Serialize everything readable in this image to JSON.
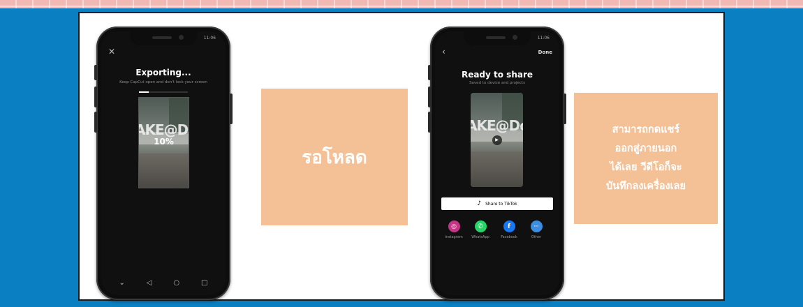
{
  "left_phone": {
    "status_left": "",
    "status_time": "11:06",
    "title": "Exporting...",
    "subtitle": "Keep CapCut open and don't lock your screen",
    "progress_fraction": 0.2,
    "percent_label": "10%",
    "video_sign": "AKE@Dome"
  },
  "right_phone": {
    "status_time": "11:06",
    "done_label": "Done",
    "title": "Ready to share",
    "subtitle": "Saved to device and projects",
    "video_sign": "AKE@Dome",
    "share_button_label": "Share to TikTok",
    "apps": [
      {
        "name": "Instagram",
        "icon": "instagram-icon",
        "color": "#c13584"
      },
      {
        "name": "WhatsApp",
        "icon": "whatsapp-icon",
        "color": "#25d366"
      },
      {
        "name": "Facebook",
        "icon": "facebook-icon",
        "color": "#1877f2"
      },
      {
        "name": "Other",
        "icon": "more-icon",
        "color": "#3d8de0"
      }
    ]
  },
  "captions": {
    "waiting": "รอโหลด",
    "share_lines": [
      "สามารถกดแชร์",
      "ออกสู่ภายนอก",
      "ได้เลย วีดีโอก็จะ",
      "บันทึกลงเครื่องเลย"
    ]
  },
  "colors": {
    "background_pink": "#f2b9b4",
    "blue_band": "#0a7fc2",
    "peach_box": "#f4c096"
  }
}
